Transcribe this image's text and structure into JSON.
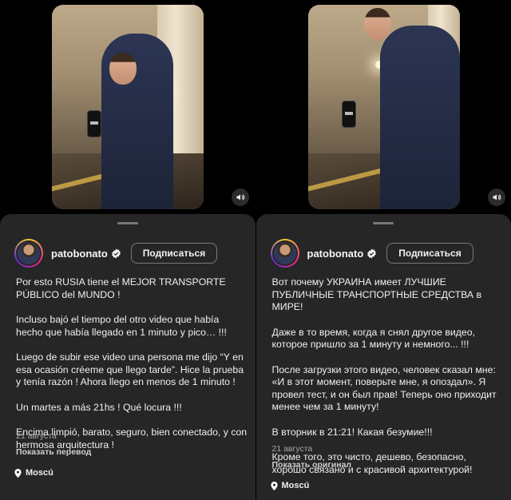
{
  "colors": {
    "sheet": "#262626",
    "background": "#000000",
    "text": "#f0f0f0",
    "muted": "#a8a8a8"
  },
  "left": {
    "username": "patobonato",
    "follow_label": "Подписаться",
    "caption": [
      "Por esto RUSIA tiene el MEJOR TRANSPORTE PÚBLICO del MUNDO !",
      "Incluso bajó el tiempo del otro video que había hecho que había llegado en 1 minuto y pico… !!!",
      "Luego de subir ese video una persona me dijo “Y en esa ocasión créeme que llego tarde”. Hice la prueba y tenía razón !  Ahora llego en menos de 1 minuto !",
      "Un martes a más 21hs ! Qué locura !!!",
      "Encima limpió, barato, seguro, bien conectado, y con hermosa arquitectura !"
    ],
    "date": "21 августа",
    "translate_label": "Показать перевод",
    "location": "Moscú"
  },
  "right": {
    "username": "patobonato",
    "follow_label": "Подписаться",
    "caption": [
      "Вот почему УКРАИНА имеет ЛУЧШИЕ ПУБЛИЧНЫЕ ТРАНСПОРТНЫЕ СРЕДСТВА в МИРЕ!",
      " Даже в то время, когда я снял другое видео, которое пришло за 1 минуту и немного... !!!",
      " После загрузки этого видео, человек сказал мне: «И в этот момент, поверьте мне, я опоздал». Я провел тест, и он был прав! Теперь оно приходит менее чем за 1 минуту!",
      " В вторник в 21:21! Какая безумие!!!",
      " Кроме того, это чисто, дешево, безопасно, хорошо связано и с красивой архитектурой!"
    ],
    "date": "21 августа",
    "translate_label": "Показать оригинал",
    "location": "Moscú"
  },
  "icons": {
    "mute": "speaker-icon",
    "verified": "verified-badge-icon",
    "location": "location-pin-icon"
  }
}
